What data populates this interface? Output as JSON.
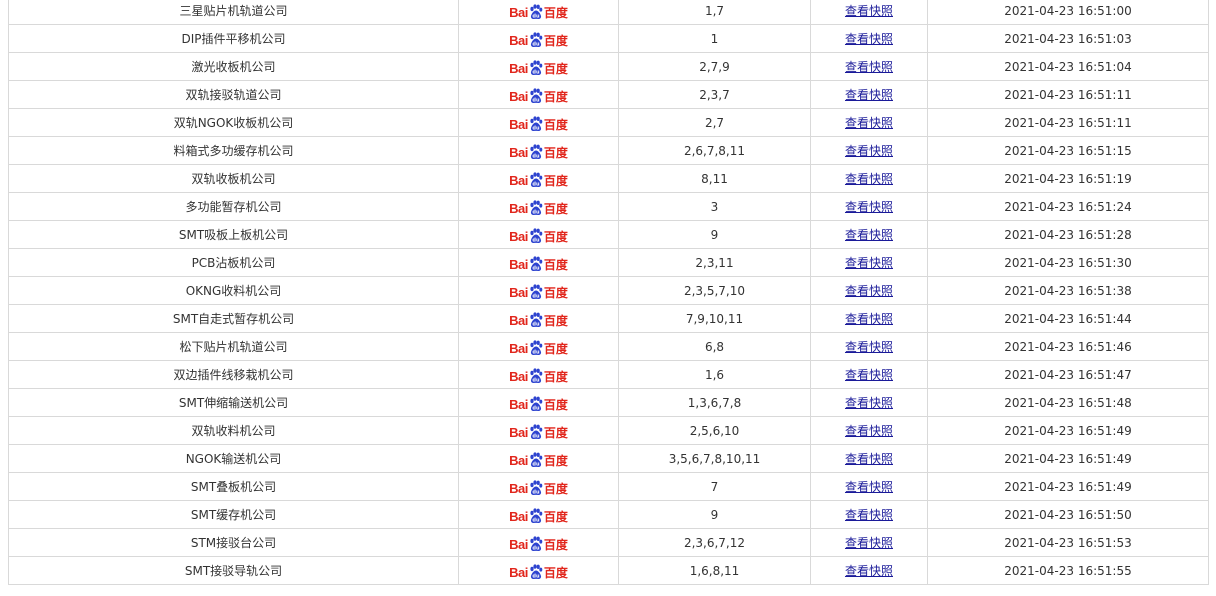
{
  "engine_logo": {
    "text_latin": "Bai",
    "text_cn": "百度",
    "icon": "baidu-paw-icon",
    "color": "#e1261c"
  },
  "snapshot_label": "查看快照",
  "link_color": "#1a1a99",
  "rows": [
    {
      "keyword": "三星贴片机轨道公司",
      "rank": "1,7",
      "time": "2021-04-23 16:51:00"
    },
    {
      "keyword": "DIP插件平移机公司",
      "rank": "1",
      "time": "2021-04-23 16:51:03"
    },
    {
      "keyword": "激光收板机公司",
      "rank": "2,7,9",
      "time": "2021-04-23 16:51:04"
    },
    {
      "keyword": "双轨接驳轨道公司",
      "rank": "2,3,7",
      "time": "2021-04-23 16:51:11"
    },
    {
      "keyword": "双轨NGOK收板机公司",
      "rank": "2,7",
      "time": "2021-04-23 16:51:11"
    },
    {
      "keyword": "料箱式多功缓存机公司",
      "rank": "2,6,7,8,11",
      "time": "2021-04-23 16:51:15"
    },
    {
      "keyword": "双轨收板机公司",
      "rank": "8,11",
      "time": "2021-04-23 16:51:19"
    },
    {
      "keyword": "多功能暂存机公司",
      "rank": "3",
      "time": "2021-04-23 16:51:24"
    },
    {
      "keyword": "SMT吸板上板机公司",
      "rank": "9",
      "time": "2021-04-23 16:51:28"
    },
    {
      "keyword": "PCB沾板机公司",
      "rank": "2,3,11",
      "time": "2021-04-23 16:51:30"
    },
    {
      "keyword": "OKNG收料机公司",
      "rank": "2,3,5,7,10",
      "time": "2021-04-23 16:51:38"
    },
    {
      "keyword": "SMT自走式暂存机公司",
      "rank": "7,9,10,11",
      "time": "2021-04-23 16:51:44"
    },
    {
      "keyword": "松下贴片机轨道公司",
      "rank": "6,8",
      "time": "2021-04-23 16:51:46"
    },
    {
      "keyword": "双边插件线移栽机公司",
      "rank": "1,6",
      "time": "2021-04-23 16:51:47"
    },
    {
      "keyword": "SMT伸缩输送机公司",
      "rank": "1,3,6,7,8",
      "time": "2021-04-23 16:51:48"
    },
    {
      "keyword": "双轨收料机公司",
      "rank": "2,5,6,10",
      "time": "2021-04-23 16:51:49"
    },
    {
      "keyword": "NGOK输送机公司",
      "rank": "3,5,6,7,8,10,11",
      "time": "2021-04-23 16:51:49"
    },
    {
      "keyword": "SMT叠板机公司",
      "rank": "7",
      "time": "2021-04-23 16:51:49"
    },
    {
      "keyword": "SMT缓存机公司",
      "rank": "9",
      "time": "2021-04-23 16:51:50"
    },
    {
      "keyword": "STM接驳台公司",
      "rank": "2,3,6,7,12",
      "time": "2021-04-23 16:51:53"
    },
    {
      "keyword": "SMT接驳导轨公司",
      "rank": "1,6,8,11",
      "time": "2021-04-23 16:51:55"
    }
  ]
}
